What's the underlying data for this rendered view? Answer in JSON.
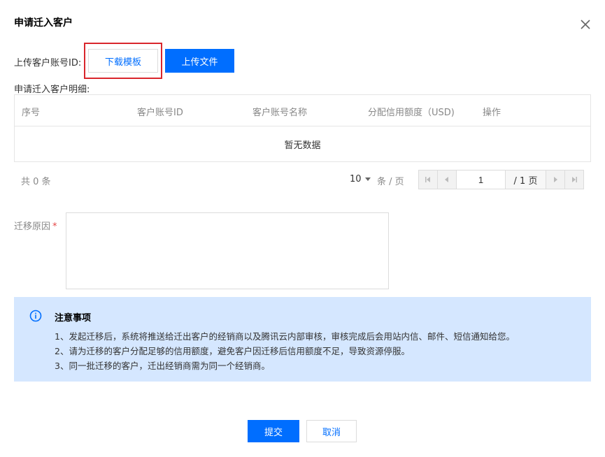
{
  "dialog": {
    "title": "申请迁入客户"
  },
  "upload": {
    "label": "上传客户账号ID:",
    "download_template_label": "下载模板",
    "upload_file_label": "上传文件"
  },
  "detail": {
    "label": "申请迁入客户明细:",
    "columns": [
      "序号",
      "客户账号ID",
      "客户账号名称",
      "分配信用额度（USD)",
      "操作"
    ],
    "empty_text": "暂无数据"
  },
  "pagination": {
    "total_text": "共 0 条",
    "page_size": "10",
    "page_unit": "条 / 页",
    "current_page": "1",
    "total_pages_text": "/ 1 页"
  },
  "reason": {
    "label": "迁移原因",
    "required_mark": "*",
    "value": ""
  },
  "notice": {
    "title": "注意事项",
    "lines": [
      "1、发起迁移后，系统将推送给迁出客户的经销商以及腾讯云内部审核，审核完成后会用站内信、邮件、短信通知给您。",
      "2、请为迁移的客户分配足够的信用额度，避免客户因迁移后信用额度不足，导致资源停服。",
      "3、同一批迁移的客户，迁出经销商需为同一个经销商。"
    ]
  },
  "footer": {
    "submit_label": "提交",
    "cancel_label": "取消"
  },
  "colors": {
    "primary": "#006eff",
    "highlight": "#d9262c",
    "notice_bg": "#d5e7ff",
    "required": "#e54545"
  },
  "icons": [
    "close-icon",
    "info-icon",
    "first-page-icon",
    "prev-page-icon",
    "next-page-icon",
    "last-page-icon",
    "caret-down-icon"
  ]
}
